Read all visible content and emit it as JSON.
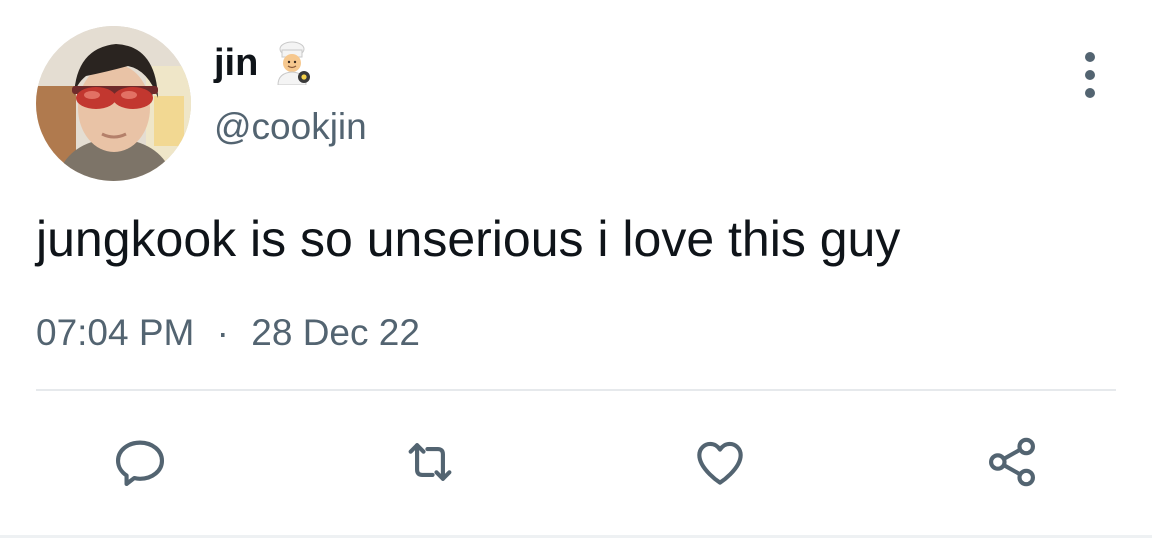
{
  "tweet": {
    "author": {
      "display_name": "jin",
      "name_emoji": "cook-emoji",
      "handle": "@cookjin"
    },
    "text": "jungkook is so unserious i love this guy",
    "time": "07:04 PM",
    "separator": "·",
    "date": "28 Dec 22"
  },
  "actions": {
    "reply_icon": "speech-bubble-icon",
    "retweet_icon": "retweet-icon",
    "like_icon": "heart-icon",
    "share_icon": "share-icon"
  },
  "menu": {
    "more_icon": "vertical-dots-icon"
  },
  "colors": {
    "text_primary": "#0f1419",
    "text_secondary": "#536471",
    "divider": "#e6e9ec"
  }
}
